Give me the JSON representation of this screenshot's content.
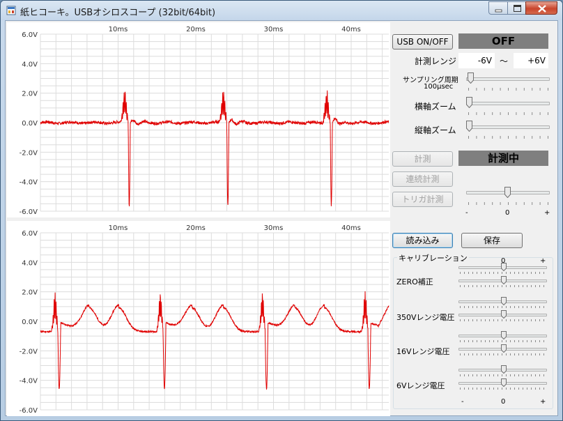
{
  "window": {
    "title": "紙ヒコーキ。USBオシロスコープ (32bit/64bit)"
  },
  "scope": {
    "y_labels": [
      "6.0V",
      "4.0V",
      "2.0V",
      "0.0V",
      "-2.0V",
      "-4.0V",
      "-6.0V"
    ],
    "x_labels": [
      "10ms",
      "20ms",
      "30ms",
      "40ms"
    ],
    "trace_color": "#e00000"
  },
  "controls": {
    "usb_button": "USB ON/OFF",
    "usb_status": "OFF",
    "range_label": "計測レンジ",
    "range_min": "-6V",
    "range_sep": "〜",
    "range_max": "+6V",
    "sampling_label": "サンプリング周期",
    "sampling_value": "100μsec",
    "sampling_slider": 0.02,
    "hzoom_label": "横軸ズーム",
    "hzoom_slider": 0,
    "vzoom_label": "縦軸ズーム",
    "vzoom_slider": 0,
    "measure_button": "計測",
    "measure_status": "計測中",
    "continuous_button": "連続計測",
    "trigger_button": "トリガ計測",
    "trigger_slider": 0.5,
    "trigger_minus": "-",
    "trigger_zero": "0",
    "trigger_plus": "+",
    "load_button": "読み込み",
    "save_button": "保存"
  },
  "calibration": {
    "title": "キャリブレーション",
    "scale_minus": "-",
    "scale_zero": "0",
    "scale_plus": "+",
    "rows": [
      {
        "label": "ZERO補正",
        "top": 0.5,
        "bottom": 0.5
      },
      {
        "label": "350Vレンジ電圧",
        "top": 0.5,
        "bottom": 0.5
      },
      {
        "label": "16Vレンジ電圧",
        "top": 0.5,
        "bottom": 0.5
      },
      {
        "label": "6Vレンジ電圧",
        "top": 0.5,
        "bottom": 0.5
      }
    ]
  }
}
